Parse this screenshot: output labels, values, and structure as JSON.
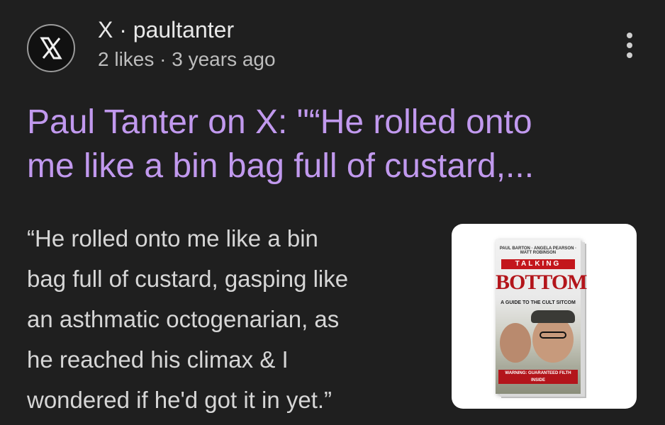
{
  "header": {
    "logo_icon": "x-logo-icon",
    "source_line": "X · paultanter",
    "meta_line": "2 likes · 3 years ago",
    "more_icon": "more-vertical-icon"
  },
  "result": {
    "title_line1": "Paul Tanter on X: \"“He rolled onto",
    "title_line2": "me like a bin bag full of custard,...",
    "snippet_lines": [
      "“He rolled onto me like a bin",
      "bag full of custard, gasping like",
      "an asthmatic octogenarian, as",
      "he reached his climax & I",
      "wondered if he'd got it in yet.”"
    ]
  },
  "thumbnail": {
    "book_top": "PAUL BARTON · ANGELA PEARSON · MATT ROBINSON",
    "book_talking": "TALKING",
    "book_bottom": "BOTTOM",
    "book_guide": "A GUIDE TO THE CULT SITCOM",
    "book_warn": "WARNING: GUARANTEED FILTH INSIDE"
  },
  "colors": {
    "background": "#1f1f1f",
    "title": "#c199ee",
    "text": "#d6d6d6",
    "meta": "#bdbdbd"
  }
}
